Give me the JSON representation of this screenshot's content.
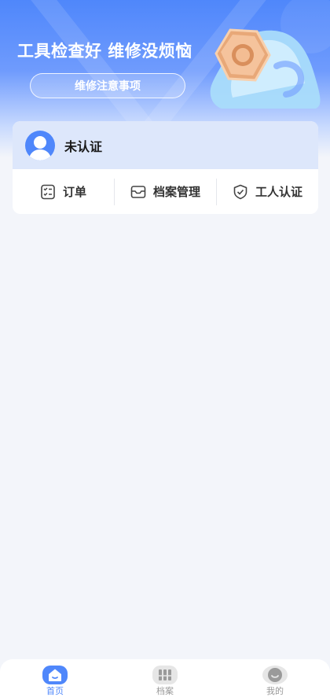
{
  "colors": {
    "brand": "#4f87fb",
    "page_background": "#f3f5fa",
    "card_header": "#dde7fb",
    "tab_inactive": "#999999"
  },
  "hero": {
    "title": "工具检查好 维修没烦恼",
    "button_label": "维修注意事项",
    "illustration": "wrench-and-nut-illustration"
  },
  "profile": {
    "avatar_icon": "user-avatar-icon",
    "status": "未认证"
  },
  "menu": {
    "items": [
      {
        "label": "订单",
        "icon": "order-list-icon"
      },
      {
        "label": "档案管理",
        "icon": "archive-box-icon"
      },
      {
        "label": "工人认证",
        "icon": "shield-check-icon"
      }
    ]
  },
  "tabbar": {
    "items": [
      {
        "label": "首页",
        "icon": "home-icon",
        "active": true
      },
      {
        "label": "档案",
        "icon": "archive-icon",
        "active": false
      },
      {
        "label": "我的",
        "icon": "profile-icon",
        "active": false
      }
    ]
  }
}
